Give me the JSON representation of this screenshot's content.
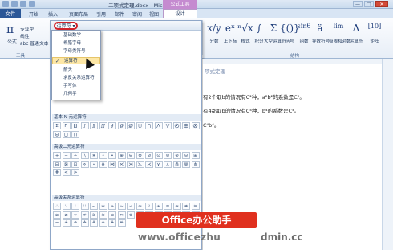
{
  "window": {
    "title": "二项式定理.docx - Microsoft Word",
    "context_tab": "公式工具",
    "controls": [
      "—",
      "□",
      "✕"
    ]
  },
  "tabs": {
    "file": "文件",
    "items": [
      "开始",
      "插入",
      "页面布局",
      "引用",
      "邮件",
      "审阅",
      "视图"
    ],
    "design": "设计"
  },
  "ribbon": {
    "formula_label": "公式",
    "tools": [
      "专业型",
      "线性",
      "abc 普通文本"
    ],
    "tools_group": "工具",
    "structure_group": "结构",
    "symbols": [
      {
        "glyph": "x/y",
        "label": "分数"
      },
      {
        "glyph": "eˣ",
        "label": "上下标"
      },
      {
        "glyph": "ⁿ√x",
        "label": "根式"
      },
      {
        "glyph": "∫",
        "label": "积分"
      },
      {
        "glyph": "Σ",
        "label": "大型运算符"
      },
      {
        "glyph": "{()}",
        "label": "括号"
      },
      {
        "glyph": "sinθ",
        "label": "函数"
      },
      {
        "glyph": "ä",
        "label": "导数符号"
      },
      {
        "glyph": "lim",
        "label": "极限和对数"
      },
      {
        "glyph": "Δ",
        "label": "运算符"
      },
      {
        "glyph": "[10]",
        "label": "矩阵"
      }
    ]
  },
  "gallery": {
    "dropdown_label": "运算符 ▾",
    "menu": [
      "基础数学",
      "希腊字母",
      "字母类符号",
      "运算符",
      "箭头",
      "求反关系运算符",
      "手写体",
      "几何学"
    ],
    "selected_menu": "运算符",
    "sections": [
      {
        "title": "基本 N 元运算符",
        "cells": [
          "Σ",
          "Π",
          "∐",
          "∫",
          "∬",
          "∭",
          "∮",
          "∯",
          "∰",
          "⋃",
          "⋂",
          "⋀",
          "⋁",
          "⨀",
          "⨁",
          "⨂",
          "⨄",
          "⨆",
          "⨅"
        ]
      },
      {
        "title": "高级二元运算符",
        "cells": [
          "∔",
          "−",
          "∸",
          "∖",
          "∗",
          "∘",
          "∙",
          "⊕",
          "⊖",
          "⊗",
          "⊘",
          "⊙",
          "⊚",
          "⊛",
          "⊝",
          "⊞",
          "⊟",
          "⊠",
          "⊡",
          "⋄",
          "⋆",
          "⋇",
          "⋈",
          "⋉",
          "⋊",
          "⋋",
          "⋌",
          "⋎",
          "⋏",
          "⋒",
          "⋓",
          "⋔",
          "⋕",
          "⋖",
          "⋗"
        ]
      },
      {
        "title": "高级关系运算符",
        "cells": [
          "∴",
          "∵",
          "∶",
          "∷",
          "∹",
          "∺",
          "∻",
          "∼",
          "∽",
          "∾",
          "≀",
          "≁",
          "≂",
          "≃",
          "≄",
          "≅",
          "≆",
          "≇",
          "≈",
          "≉",
          "≊",
          "≋",
          "≌",
          "≍",
          "≎",
          "≏",
          "≐",
          "≑",
          "≒",
          "≓",
          "≔",
          "≕",
          "≖",
          "≗",
          "≘",
          "≙",
          "≚",
          "≛",
          "≜",
          "≝"
        ]
      }
    ]
  },
  "document": {
    "heading": "项式定理",
    "lines": [
      "有2个取b的情况有C²种，a²b²的系数是C²。",
      "有4都取b的情况有C⁴种，b⁴的系数是C⁴。",
      "C⁴b⁴。"
    ]
  },
  "watermark": {
    "banner": "Office办公助手",
    "url_left": "www.officezhu",
    "url_right": "dmin.cc"
  },
  "colors": {
    "file_tab": "#2b5797",
    "context_tab": "#c58bd0",
    "highlight_ring": "#d2232a",
    "banner": "#e0301e"
  }
}
